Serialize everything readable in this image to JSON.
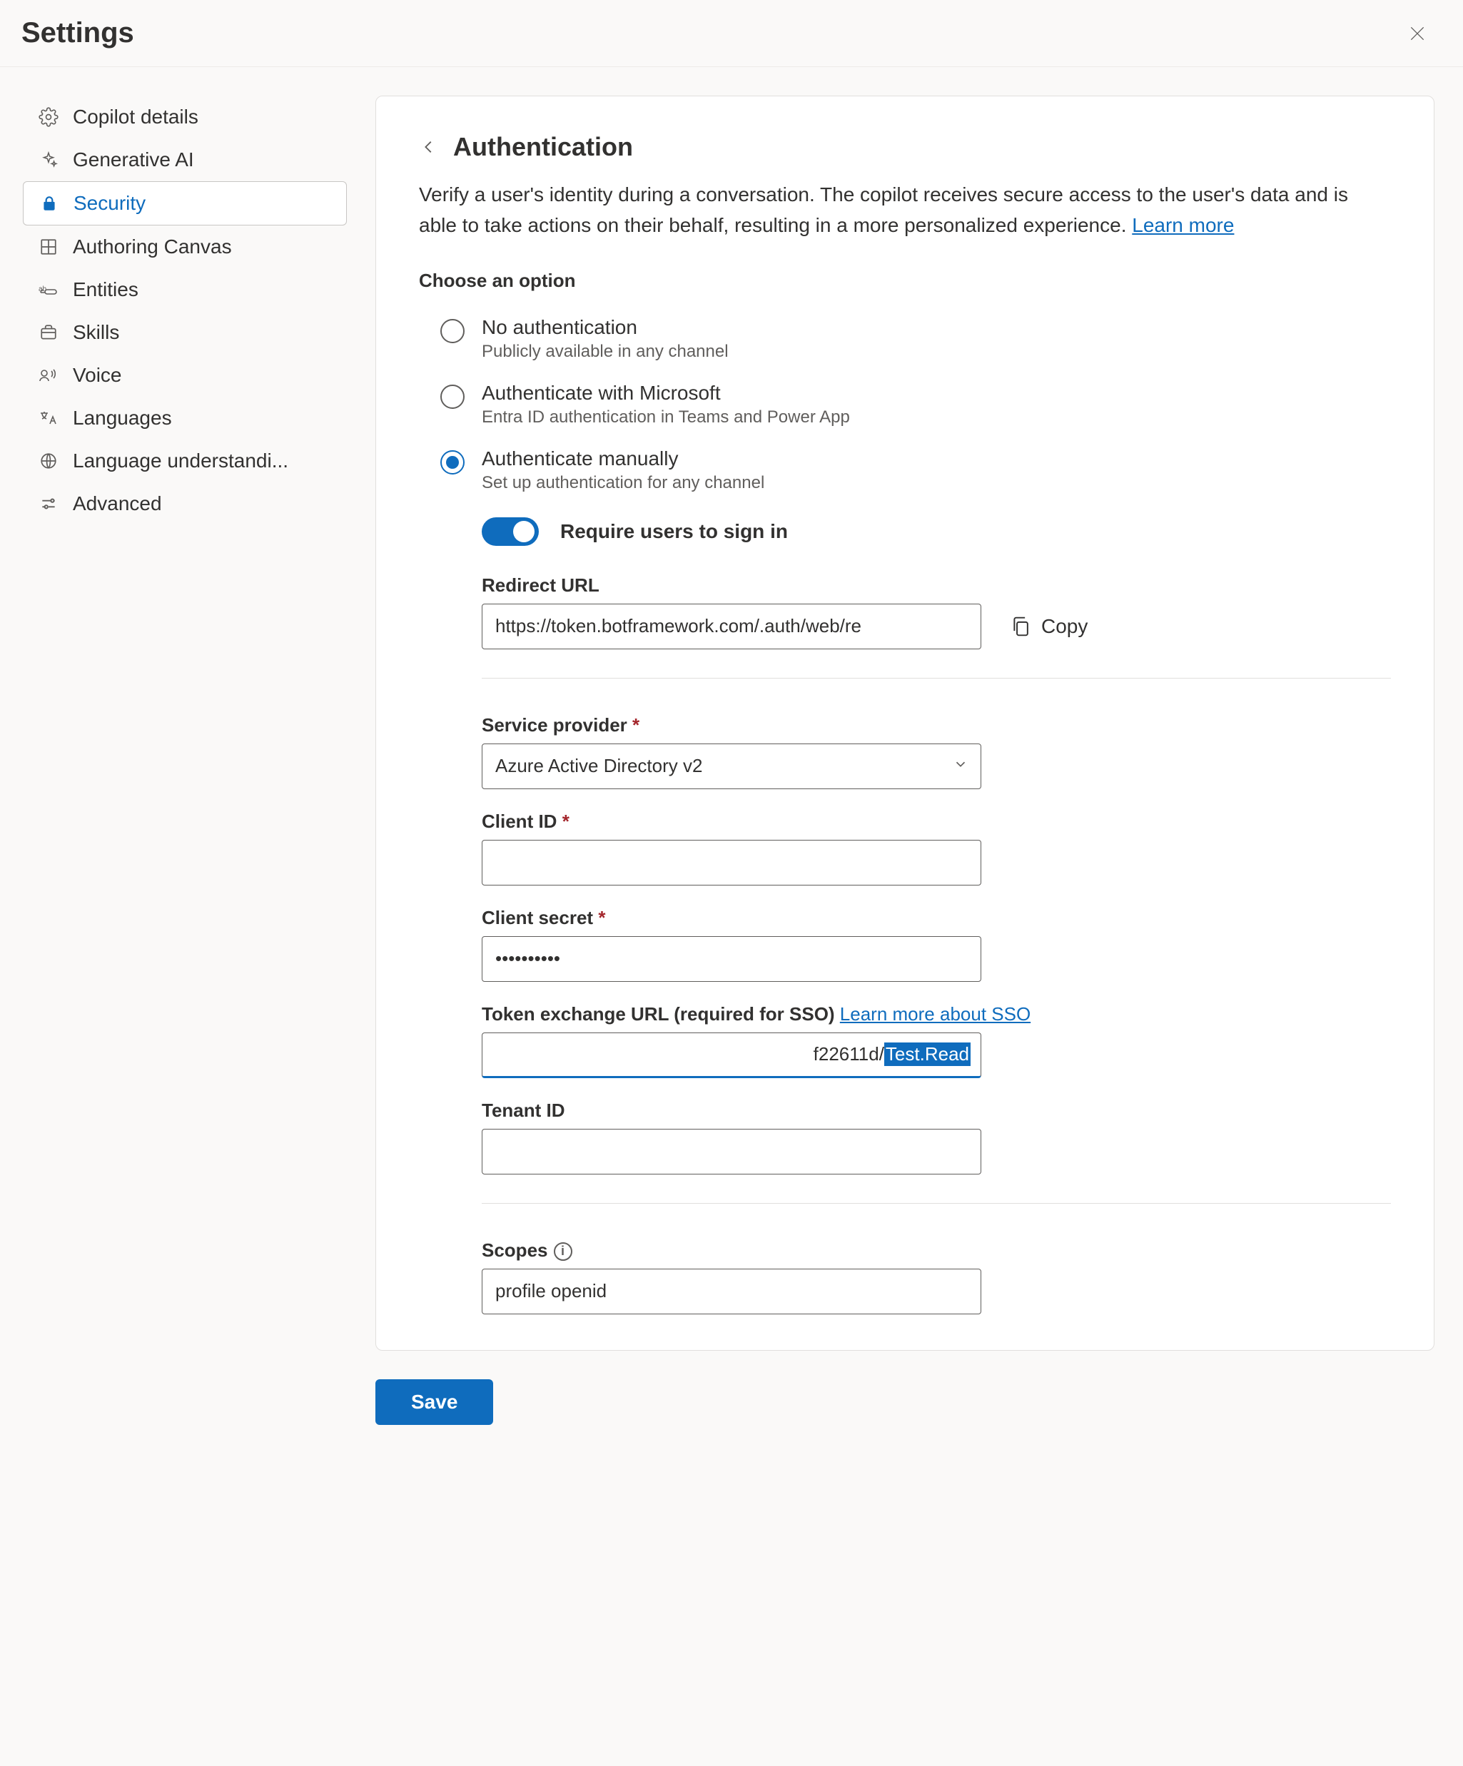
{
  "header": {
    "title": "Settings"
  },
  "sidebar": {
    "items": [
      {
        "label": "Copilot details"
      },
      {
        "label": "Generative AI"
      },
      {
        "label": "Security"
      },
      {
        "label": "Authoring Canvas"
      },
      {
        "label": "Entities"
      },
      {
        "label": "Skills"
      },
      {
        "label": "Voice"
      },
      {
        "label": "Languages"
      },
      {
        "label": "Language understandi..."
      },
      {
        "label": "Advanced"
      }
    ]
  },
  "panel": {
    "title": "Authentication",
    "description_prefix": "Verify a user's identity during a conversation. The copilot receives secure access to the user's data and is able to take actions on their behalf, resulting in a more personalized experience. ",
    "learn_more": "Learn more",
    "choose_label": "Choose an option",
    "options": [
      {
        "label": "No authentication",
        "sub": "Publicly available in any channel"
      },
      {
        "label": "Authenticate with Microsoft",
        "sub": "Entra ID authentication in Teams and Power App"
      },
      {
        "label": "Authenticate manually",
        "sub": "Set up authentication for any channel"
      }
    ],
    "require_signin_label": "Require users to sign in",
    "redirect": {
      "label": "Redirect URL",
      "value": "https://token.botframework.com/.auth/web/re",
      "copy": "Copy"
    },
    "service_provider": {
      "label": "Service provider",
      "value": "Azure Active Directory v2"
    },
    "client_id": {
      "label": "Client ID",
      "value": ""
    },
    "client_secret": {
      "label": "Client secret",
      "value": "••••••••••"
    },
    "token_exchange": {
      "label_prefix": "Token exchange URL (required for SSO) ",
      "link": "Learn more about SSO",
      "value_plain": "f22611d/",
      "value_selected": "Test.Read"
    },
    "tenant_id": {
      "label": "Tenant ID",
      "value": ""
    },
    "scopes": {
      "label": "Scopes",
      "value": "profile openid"
    }
  },
  "footer": {
    "save": "Save"
  }
}
